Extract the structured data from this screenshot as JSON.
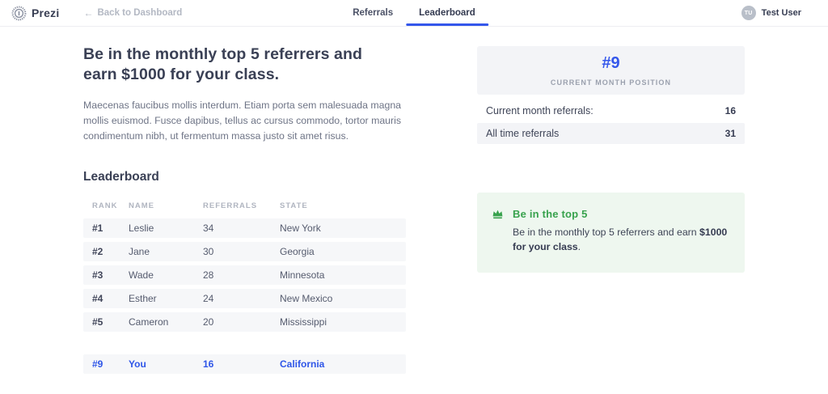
{
  "brand": {
    "name": "Prezi",
    "logo_icon": "medal-badge"
  },
  "nav": {
    "back_arrow": "←",
    "back_label": "Back to Dashboard",
    "tabs": [
      {
        "label": "Referrals",
        "active": false
      },
      {
        "label": "Leaderboard",
        "active": true
      }
    ],
    "user": {
      "initials": "TU",
      "name": "Test User"
    }
  },
  "main": {
    "headline": "Be in the monthly top 5 referrers and earn $1000 for your class.",
    "description": "Maecenas faucibus mollis interdum. Etiam porta sem malesuada magna mollis euismod. Fusce dapibus, tellus ac cursus commodo, tortor mauris condimentum nibh, ut fermentum massa justo sit amet risus.",
    "leaderboard": {
      "title": "Leaderboard",
      "columns": [
        "RANK",
        "NAME",
        "REFERRALS",
        "STATE"
      ],
      "rows": [
        {
          "rank": "#1",
          "name": "Leslie",
          "referrals": "34",
          "state": "New York"
        },
        {
          "rank": "#2",
          "name": "Jane",
          "referrals": "30",
          "state": "Georgia"
        },
        {
          "rank": "#3",
          "name": "Wade",
          "referrals": "28",
          "state": "Minnesota"
        },
        {
          "rank": "#4",
          "name": "Esther",
          "referrals": "24",
          "state": "New Mexico"
        },
        {
          "rank": "#5",
          "name": "Cameron",
          "referrals": "20",
          "state": "Mississippi"
        }
      ],
      "you_row": {
        "rank": "#9",
        "name": "You",
        "referrals": "16",
        "state": "California"
      }
    }
  },
  "sidebar": {
    "position_card": {
      "position": "#9",
      "label": "CURRENT MONTH POSITION"
    },
    "stats": [
      {
        "label": "Current month referrals:",
        "value": "16"
      },
      {
        "label": "All time referrals",
        "value": "31"
      }
    ],
    "promo": {
      "icon": "crown",
      "title": "Be in the top 5",
      "body_regular": "Be in the monthly top 5 referrers and earn ",
      "body_bold": "$1000 for your class",
      "body_suffix": "."
    }
  },
  "colors": {
    "accent_blue": "#3457eb",
    "green": "#38a24d",
    "green_bg": "#eef7ef",
    "row_bg": "#f6f7f9",
    "box_bg": "#f3f4f7",
    "muted_gray": "#b0b5c0",
    "text_dark": "#3a4055"
  }
}
